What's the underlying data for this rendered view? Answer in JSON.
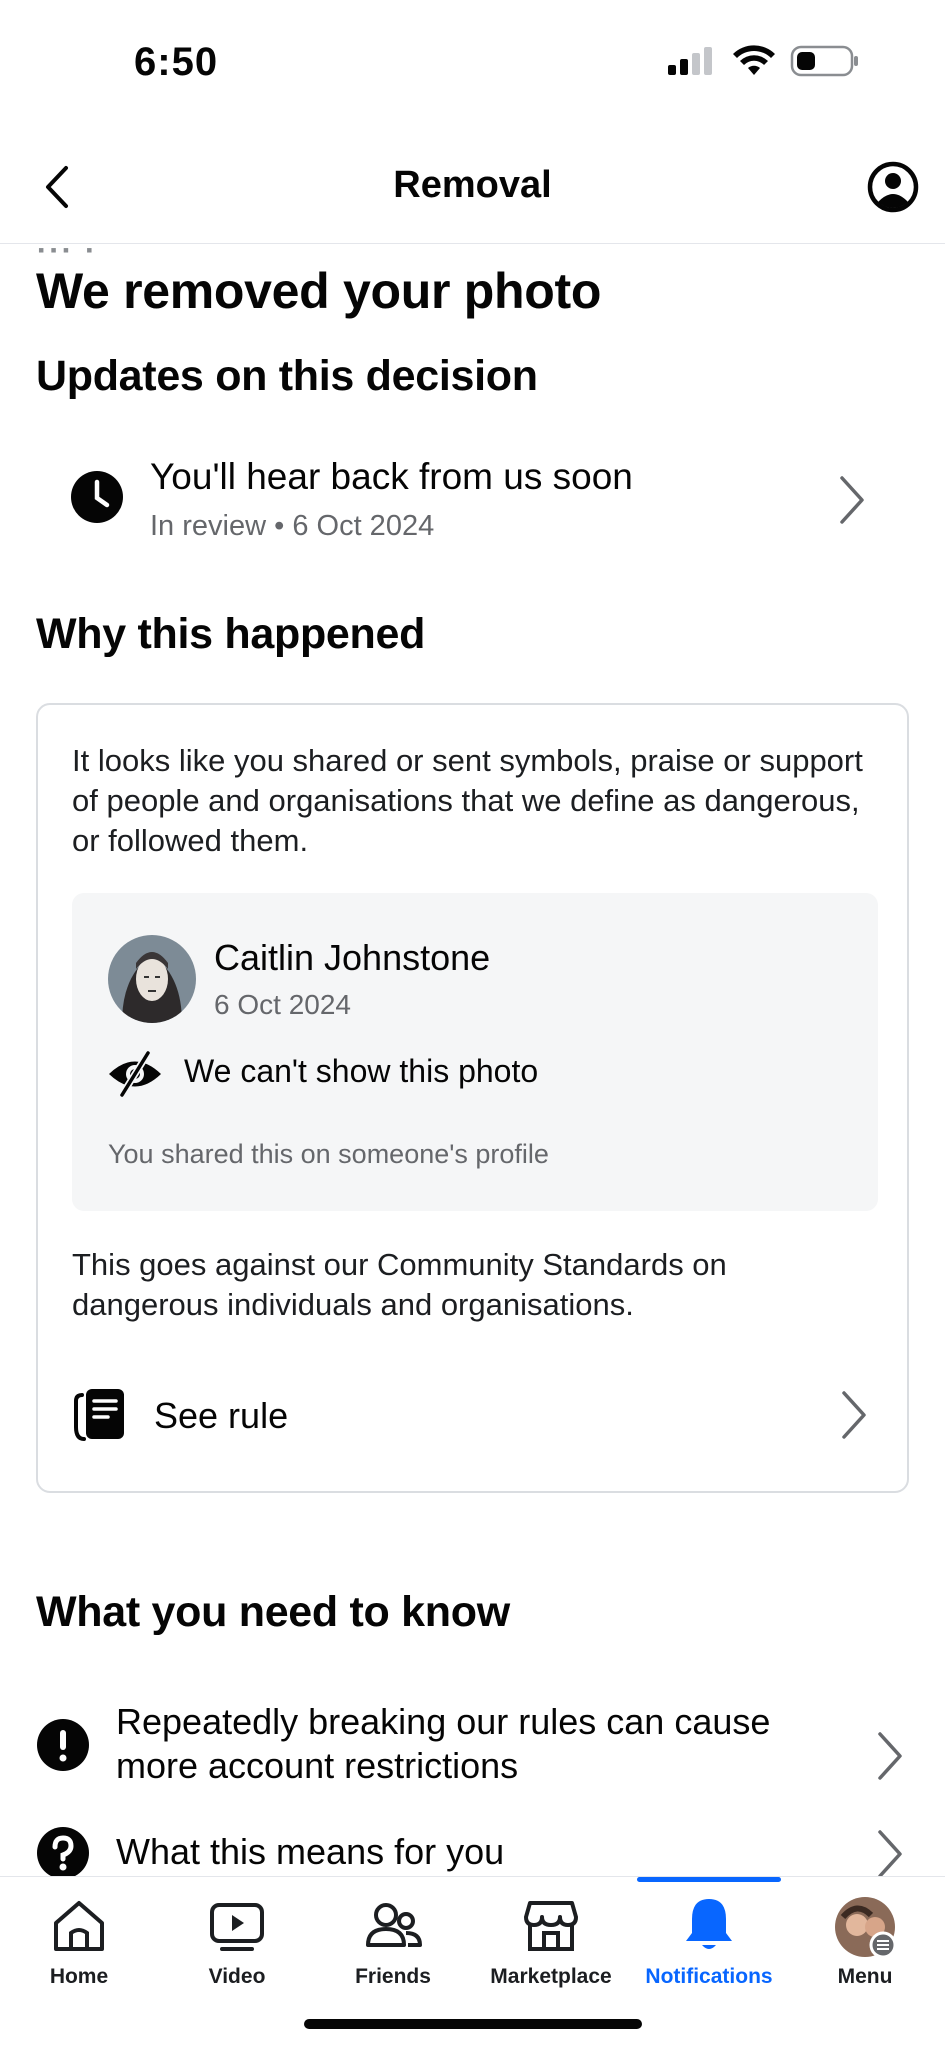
{
  "status_bar": {
    "time": "6:50"
  },
  "header": {
    "title": "Removal"
  },
  "main": {
    "heading": "We removed your photo",
    "updates_heading": "Updates on this decision",
    "update": {
      "title": "You'll hear back from us soon",
      "status": "In review",
      "separator": "•",
      "date": "6 Oct 2024"
    },
    "why_heading": "Why this happened",
    "card": {
      "explanation": "It looks like you shared or sent symbols, praise or support of people and organisations that we define as dangerous, or followed them.",
      "post": {
        "author": "Caitlin Johnstone",
        "date": "6 Oct 2024",
        "hidden_text": "We can't show this photo",
        "shared_note": "You shared this on someone's profile"
      },
      "standards_text": "This goes against our Community Standards on dangerous individuals and organisations.",
      "see_rule_label": "See rule"
    },
    "know_heading": "What you need to know",
    "know_items": [
      {
        "icon": "exclamation-icon",
        "label": "Repeatedly breaking our rules can cause more account restrictions"
      },
      {
        "icon": "question-icon",
        "label": "What this means for you"
      }
    ]
  },
  "bottom_nav": {
    "items": [
      {
        "label": "Home",
        "icon": "home-icon"
      },
      {
        "label": "Video",
        "icon": "video-icon"
      },
      {
        "label": "Friends",
        "icon": "friends-icon"
      },
      {
        "label": "Marketplace",
        "icon": "marketplace-icon"
      },
      {
        "label": "Notifications",
        "icon": "bell-icon",
        "active": true
      },
      {
        "label": "Menu",
        "icon": "avatar"
      }
    ],
    "active_color": "#0866ff"
  }
}
